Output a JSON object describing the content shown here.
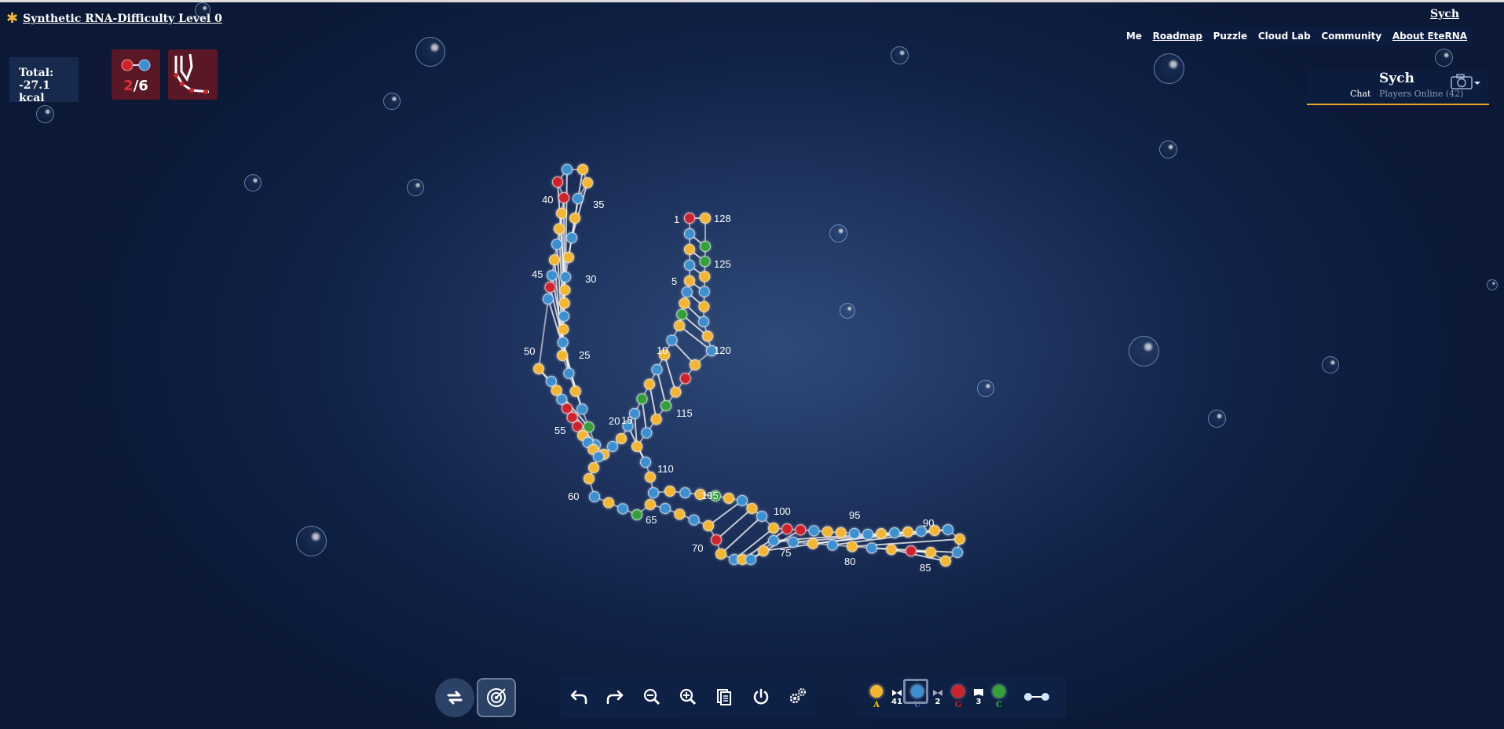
{
  "header": {
    "puzzle_title": "Synthetic RNA-Difficulty Level 0",
    "user_link": "Sych",
    "nav": [
      "Me",
      "Roadmap",
      "Puzzle",
      "Cloud Lab",
      "Community",
      "About EteRNA"
    ]
  },
  "chat": {
    "username": "Sych",
    "chat_tab": "Chat",
    "players_tab": "Players Online (42)"
  },
  "energy": {
    "label": "Total:",
    "value": "-27.1 kcal"
  },
  "constraints": {
    "pairs_count": "2",
    "pairs_total": "/6"
  },
  "palette": {
    "a_label": "A",
    "u_label": "U",
    "g_label": "G",
    "c_label": "C",
    "au_count": "41",
    "ug_count": "2",
    "gc_count": "3"
  },
  "colors": {
    "A": "#f2b632",
    "U": "#3d8fd0",
    "G": "#d0222d",
    "C": "#36a03a",
    "label_A": "#f6c800",
    "label_U": "#4a6ad0",
    "label_G": "#e02020",
    "label_C": "#30c030",
    "constraint_bg": "#5a1725",
    "accent": "#e8a826"
  },
  "rna": {
    "length": 128,
    "sequence": "GUAUAUACAUAUACUUAUAUCUAUAUAUAAUAUAUAAUGGAAUAUGUAUAUGGGAUAUAAUAUCAUAUAGAUAUAUUAUAUAGAAUAUAUAUAUUAAUGGAUAUACAUAUAUAUACAGAUAUAUACC",
    "labels": [
      "1",
      "5",
      "10",
      "15",
      "20",
      "25",
      "30",
      "35",
      "40",
      "45",
      "50",
      "55",
      "60",
      "65",
      "70",
      "75",
      "80",
      "85",
      "90",
      "95",
      "100",
      "105",
      "110",
      "115",
      "120",
      "125",
      "128"
    ]
  }
}
